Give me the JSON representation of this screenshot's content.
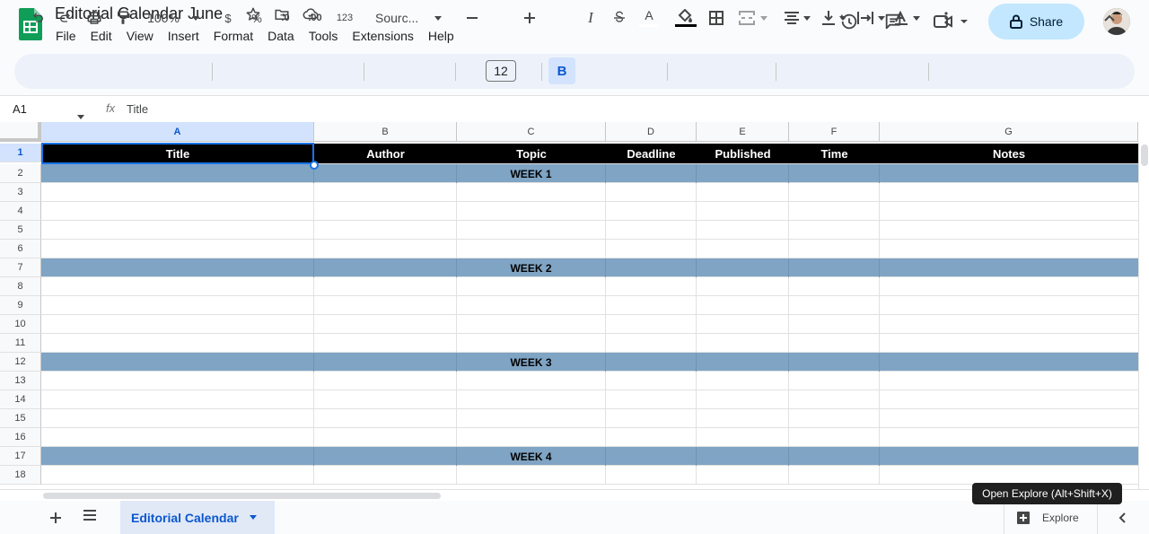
{
  "app": {
    "doc_title": "Editorial Calendar June",
    "menu": [
      "File",
      "Edit",
      "View",
      "Insert",
      "Format",
      "Data",
      "Tools",
      "Extensions",
      "Help"
    ],
    "share_label": "Share"
  },
  "toolbar": {
    "zoom": "100%",
    "currency": "$",
    "percent": "%",
    "dec_decrease": ".0",
    "dec_increase": ".00",
    "number_format": "123",
    "font": "Sourc...",
    "font_size": "12",
    "bold": "B",
    "italic": "I",
    "text_color": "A"
  },
  "formula_bar": {
    "cell_ref": "A1",
    "fx": "fx",
    "content": "Title"
  },
  "sheet": {
    "columns": [
      "A",
      "B",
      "C",
      "D",
      "E",
      "F",
      "G"
    ],
    "rows": [
      "1",
      "2",
      "3",
      "4",
      "5",
      "6",
      "7",
      "8",
      "9",
      "10",
      "11",
      "12",
      "13",
      "14",
      "15",
      "16",
      "17",
      "18"
    ],
    "headers": [
      "Title",
      "Author",
      "Topic",
      "Deadline",
      "Published",
      "Time",
      "Notes"
    ],
    "weeks": [
      "WEEK 1",
      "WEEK 2",
      "WEEK 3",
      "WEEK 4"
    ],
    "selected_cell": "A1"
  },
  "bottom": {
    "active_tab": "Editorial Calendar",
    "explore_label": "Explore",
    "tooltip": "Open Explore (Alt+Shift+X)"
  },
  "colors": {
    "header_bg": "#000000",
    "week_band": "#7fa4c4",
    "share_bg": "#c2e7ff",
    "accent": "#0b57d0"
  }
}
